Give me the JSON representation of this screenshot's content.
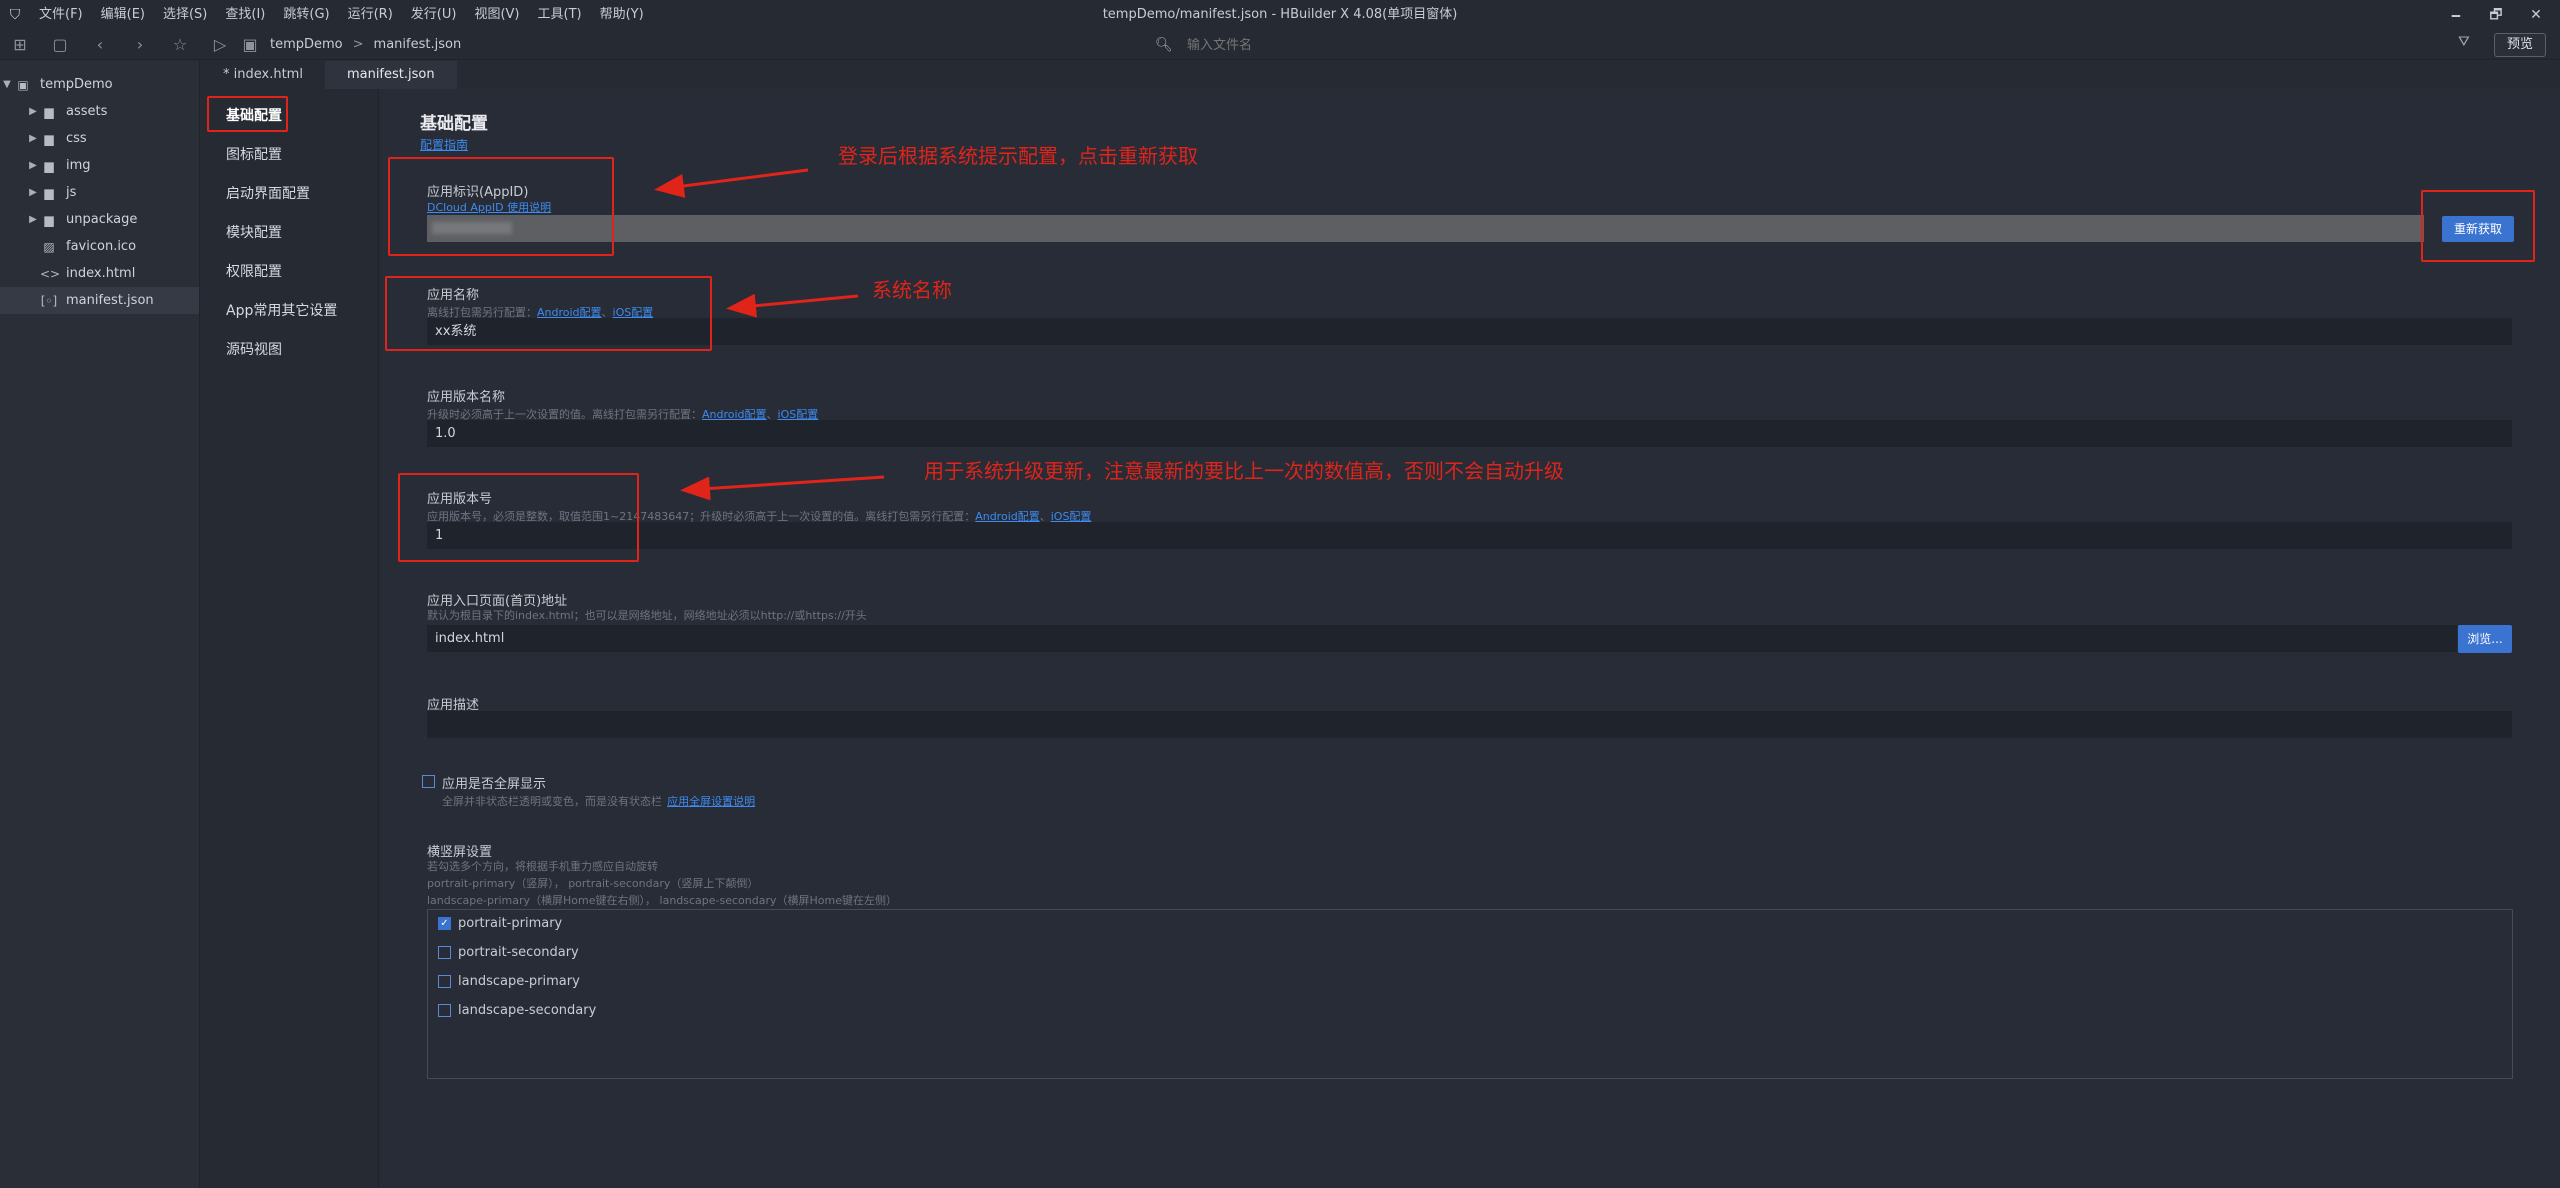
{
  "window": {
    "title": "tempDemo/manifest.json - HBuilder X 4.08(单项目窗体)",
    "minimize": "🗕",
    "restore": "🗗",
    "close": "✕"
  },
  "menu": [
    "文件(F)",
    "编辑(E)",
    "选择(S)",
    "查找(I)",
    "跳转(G)",
    "运行(R)",
    "发行(U)",
    "视图(V)",
    "工具(T)",
    "帮助(Y)"
  ],
  "toolbar": {
    "breadcrumb_project": "tempDemo",
    "breadcrumb_sep": ">",
    "breadcrumb_file": "manifest.json",
    "file_search_placeholder": "输入文件名",
    "preview_label": "预览"
  },
  "file_tree": {
    "project": "tempDemo",
    "items": [
      {
        "name": "assets",
        "type": "folder"
      },
      {
        "name": "css",
        "type": "folder"
      },
      {
        "name": "img",
        "type": "folder"
      },
      {
        "name": "js",
        "type": "folder"
      },
      {
        "name": "unpackage",
        "type": "folder"
      },
      {
        "name": "favicon.ico",
        "type": "image"
      },
      {
        "name": "index.html",
        "type": "code"
      },
      {
        "name": "manifest.json",
        "type": "json",
        "active": true
      }
    ]
  },
  "tabs": [
    {
      "label": "* index.html",
      "active": false
    },
    {
      "label": "manifest.json",
      "active": true
    }
  ],
  "settings_nav": [
    {
      "label": "基础配置",
      "active": true
    },
    {
      "label": "图标配置"
    },
    {
      "label": "启动界面配置"
    },
    {
      "label": "模块配置"
    },
    {
      "label": "权限配置"
    },
    {
      "label": "App常用其它设置"
    },
    {
      "label": "源码视图"
    }
  ],
  "basic": {
    "title": "基础配置",
    "guide_link": "配置指南",
    "appid": {
      "label": "应用标识(AppID)",
      "link": "DCloud AppID 使用说明",
      "value": "",
      "refetch_label": "重新获取"
    },
    "app_name": {
      "label": "应用名称",
      "hint": "离线打包需另行配置：",
      "android_link": "Android配置",
      "ios_link": "iOS配置",
      "value": "xx系统"
    },
    "version_name": {
      "label": "应用版本名称",
      "hint": "升级时必须高于上一次设置的值。离线打包需另行配置：",
      "android_link": "Android配置",
      "ios_link": "iOS配置",
      "value": "1.0"
    },
    "version_code": {
      "label": "应用版本号",
      "hint": "应用版本号，必须是整数，取值范围1~2147483647；升级时必须高于上一次设置的值。离线打包需另行配置：",
      "android_link": "Android配置",
      "ios_link": "iOS配置",
      "value": "1"
    },
    "entry_page": {
      "label": "应用入口页面(首页)地址",
      "hint": "默认为根目录下的index.html；也可以是网络地址，网络地址必须以http://或https://开头",
      "value": "index.html",
      "browse_label": "浏览..."
    },
    "description": {
      "label": "应用描述",
      "value": ""
    },
    "fullscreen": {
      "label": "应用是否全屏显示",
      "hint": "全屏并非状态栏透明或变色，而是没有状态栏",
      "link": "应用全屏设置说明",
      "checked": false
    },
    "orientation": {
      "label": "横竖屏设置",
      "hint1": "若勾选多个方向，将根据手机重力感应自动旋转",
      "hint2": "portrait-primary（竖屏）， portrait-secondary（竖屏上下颠倒）",
      "hint3": "landscape-primary（横屏Home键在右侧）， landscape-secondary（横屏Home键在左侧）",
      "options": [
        {
          "label": "portrait-primary",
          "checked": true
        },
        {
          "label": "portrait-secondary",
          "checked": false
        },
        {
          "label": "landscape-primary",
          "checked": false
        },
        {
          "label": "landscape-secondary",
          "checked": false
        }
      ]
    }
  },
  "annotations": {
    "appid_note": "登录后根据系统提示配置，点击重新获取",
    "name_note": "系统名称",
    "version_note": "用于系统升级更新，注意最新的要比上一次的数值高，否则不会自动升级"
  },
  "colors": {
    "background": "#272b35",
    "accent": "#3a74d0",
    "link": "#3d8bf0",
    "annotation": "#e0241a"
  }
}
